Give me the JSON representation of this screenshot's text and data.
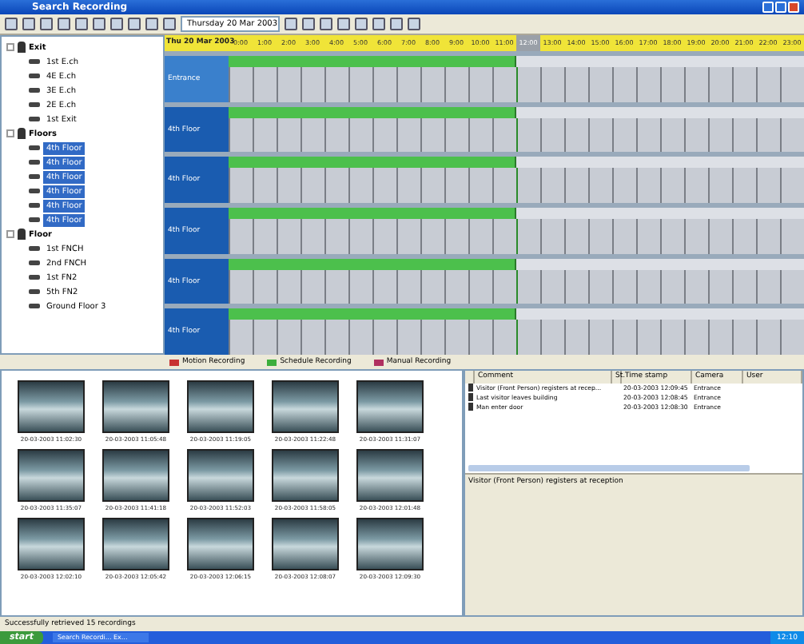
{
  "window": {
    "title": "Search Recording"
  },
  "toolbar": {
    "date": "Thursday 20 Mar 2003"
  },
  "tree": [
    {
      "label": "Exit",
      "expanded": true,
      "children": [
        {
          "label": "1st E.ch",
          "selected": false
        },
        {
          "label": "4E E.ch",
          "selected": false
        },
        {
          "label": "3E E.ch",
          "selected": false
        },
        {
          "label": "2E E.ch",
          "selected": false
        },
        {
          "label": "1st Exit",
          "selected": false
        }
      ]
    },
    {
      "label": "Floors",
      "expanded": true,
      "children": [
        {
          "label": "4th Floor",
          "selected": true
        },
        {
          "label": "4th Floor",
          "selected": true
        },
        {
          "label": "4th Floor",
          "selected": true
        },
        {
          "label": "4th Floor",
          "selected": true
        },
        {
          "label": "4th Floor",
          "selected": true
        },
        {
          "label": "4th Floor",
          "selected": true
        }
      ]
    },
    {
      "label": "Floor",
      "expanded": true,
      "children": [
        {
          "label": "1st FNCH",
          "selected": false
        },
        {
          "label": "2nd FNCH",
          "selected": false
        },
        {
          "label": "1st FN2",
          "selected": false
        },
        {
          "label": "5th FN2",
          "selected": false
        },
        {
          "label": "Ground Floor 3",
          "selected": false
        }
      ]
    }
  ],
  "timeline": {
    "date": "Thu 20 Mar 2003",
    "hours": [
      {
        "label": "0:00",
        "current": false
      },
      {
        "label": "1:00",
        "current": false
      },
      {
        "label": "2:00",
        "current": false
      },
      {
        "label": "3:00",
        "current": false
      },
      {
        "label": "4:00",
        "current": false
      },
      {
        "label": "5:00",
        "current": false
      },
      {
        "label": "6:00",
        "current": false
      },
      {
        "label": "7:00",
        "current": false
      },
      {
        "label": "8:00",
        "current": false
      },
      {
        "label": "9:00",
        "current": false
      },
      {
        "label": "10:00",
        "current": false
      },
      {
        "label": "11:00",
        "current": false
      },
      {
        "label": "12:00",
        "current": true
      },
      {
        "label": "13:00",
        "current": false
      },
      {
        "label": "14:00",
        "current": false
      },
      {
        "label": "15:00",
        "current": false
      },
      {
        "label": "16:00",
        "current": false
      },
      {
        "label": "17:00",
        "current": false
      },
      {
        "label": "18:00",
        "current": false
      },
      {
        "label": "19:00",
        "current": false
      },
      {
        "label": "20:00",
        "current": false
      },
      {
        "label": "21:00",
        "current": false
      },
      {
        "label": "22:00",
        "current": false
      },
      {
        "label": "23:00",
        "current": false
      }
    ],
    "rows": [
      {
        "label": "Entrance",
        "selected": true,
        "level": 0.5
      },
      {
        "label": "4th Floor",
        "selected": false,
        "level": 0.5
      },
      {
        "label": "4th Floor",
        "selected": false,
        "level": 0.5
      },
      {
        "label": "4th Floor",
        "selected": false,
        "level": 0.5
      },
      {
        "label": "4th Floor",
        "selected": false,
        "level": 0.5
      },
      {
        "label": "4th Floor",
        "selected": false,
        "level": 0.5
      }
    ]
  },
  "legend": [
    {
      "label": "Motion Recording",
      "color": "#c83232"
    },
    {
      "label": "Schedule Recording",
      "color": "#3cae3c"
    },
    {
      "label": "Manual Recording",
      "color": "#b03060"
    }
  ],
  "thumbnails": [
    {
      "time": "20-03-2003 11:02:30"
    },
    {
      "time": "20-03-2003 11:05:48"
    },
    {
      "time": "20-03-2003 11:19:05"
    },
    {
      "time": "20-03-2003 11:22:48"
    },
    {
      "time": "20-03-2003 11:31:07"
    },
    {
      "time": "20-03-2003 11:35:07"
    },
    {
      "time": "20-03-2003 11:41:18"
    },
    {
      "time": "20-03-2003 11:52:03"
    },
    {
      "time": "20-03-2003 11:58:05"
    },
    {
      "time": "20-03-2003 12:01:48"
    },
    {
      "time": "20-03-2003 12:02:10"
    },
    {
      "time": "20-03-2003 12:05:42"
    },
    {
      "time": "20-03-2003 12:06:15"
    },
    {
      "time": "20-03-2003 12:08:07"
    },
    {
      "time": "20-03-2003 12:09:30"
    }
  ],
  "events": {
    "columns": [
      "Comment",
      "St.",
      "Time stamp",
      "Camera",
      "User"
    ],
    "rows": [
      {
        "comment": "Visitor (Front Person) registers at recep...",
        "time": "20-03-2003 12:09:45",
        "camera": "Entrance"
      },
      {
        "comment": "Last visitor leaves building",
        "time": "20-03-2003 12:08:45",
        "camera": "Entrance"
      },
      {
        "comment": "Man enter door",
        "time": "20-03-2003 12:08:30",
        "camera": "Entrance"
      }
    ]
  },
  "details": "Visitor (Front Person) registers at reception",
  "status_bar": "Successfully retrieved 15 recordings",
  "taskbar": {
    "start": "start",
    "task": "Search Recordi... Ex...",
    "clock": "12:10"
  }
}
